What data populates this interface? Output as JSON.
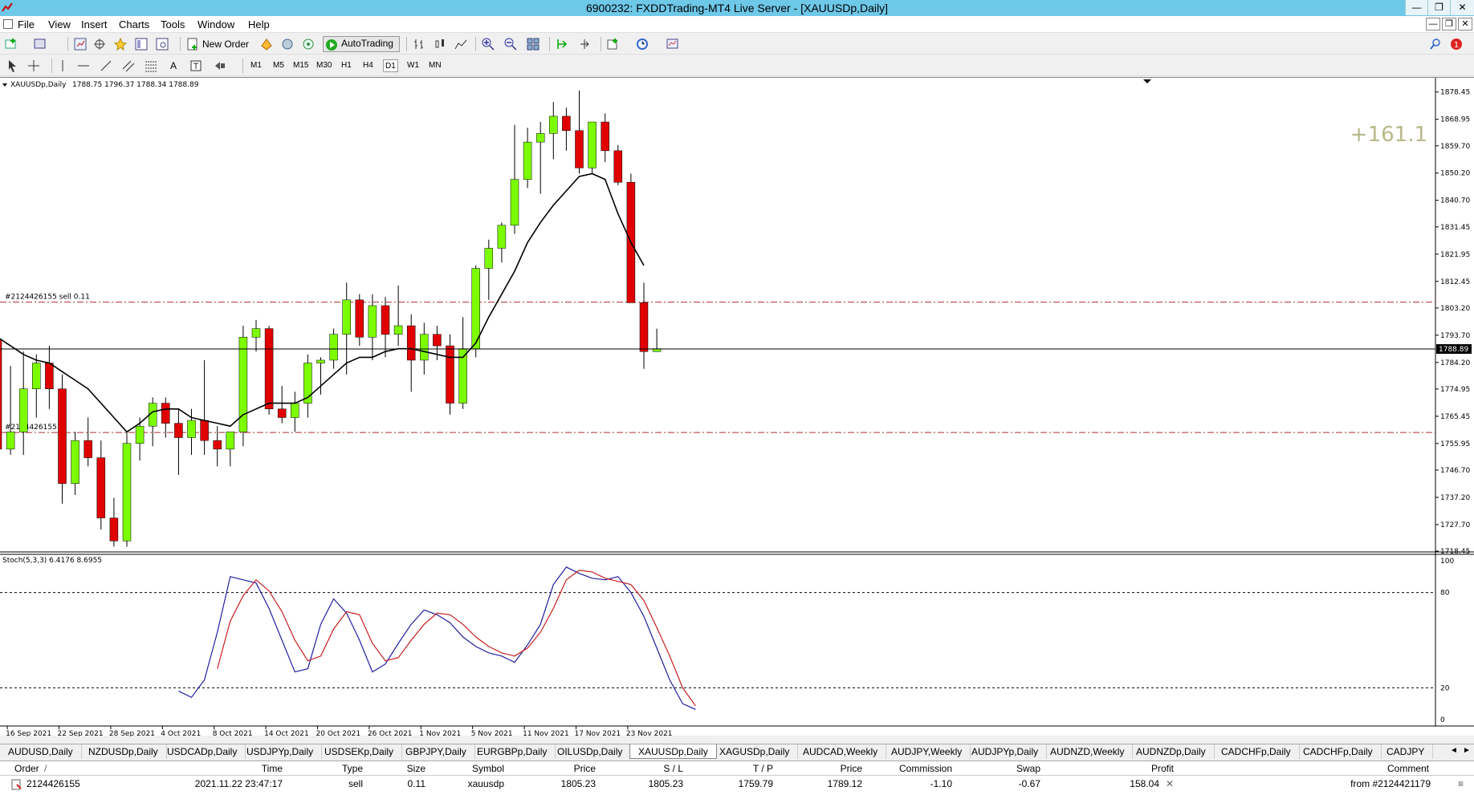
{
  "window": {
    "title": "6900232: FXDDTrading-MT4 Live Server - [XAUUSDp,Daily]"
  },
  "menu": [
    "File",
    "View",
    "Insert",
    "Charts",
    "Tools",
    "Window",
    "Help"
  ],
  "toolbar": {
    "new_order": "New Order",
    "auto_trading": "AutoTrading"
  },
  "timeframes": [
    "M1",
    "M5",
    "M15",
    "M30",
    "H1",
    "H4",
    "D1",
    "W1",
    "MN"
  ],
  "active_timeframe": "D1",
  "colors": {
    "bull": "#7cfc00",
    "bear": "#e00000",
    "stoch_main": "#1f1fa0",
    "stoch_signal": "#c81e1e",
    "order_line": "#b03030",
    "profit_text": "#b8b88a"
  },
  "chart_data": {
    "type": "candlestick",
    "symbol_label": "XAUUSDp,Daily",
    "ohlc_label": "1788.75 1796.37 1788.34 1788.89",
    "profit_label": "+161.1",
    "current_price_label": "1788.89",
    "current_price": 1788.89,
    "order_line_sell": {
      "label": "#2124426155 sell 0.11",
      "price": 1805.23
    },
    "order_line_tp": {
      "label": "#2124426155 tp",
      "price": 1759.79
    },
    "ylim": [
      1718.45,
      1882.0
    ],
    "price_ticks": [
      "1878.45",
      "1868.95",
      "1859.70",
      "1850.20",
      "1840.70",
      "1831.45",
      "1821.95",
      "1812.45",
      "1803.20",
      "1793.70",
      "1784.20",
      "1774.95",
      "1765.45",
      "1755.95",
      "1746.70",
      "1737.20",
      "1727.70",
      "1718.45"
    ],
    "date_labels": [
      "16 Sep 2021",
      "22 Sep 2021",
      "28 Sep 2021",
      "4 Oct 2021",
      "8 Oct 2021",
      "14 Oct 2021",
      "20 Oct 2021",
      "26 Oct 2021",
      "1 Nov 2021",
      "5 Nov 2021",
      "11 Nov 2021",
      "17 Nov 2021",
      "23 Nov 2021"
    ],
    "date_label_bars": [
      1,
      5,
      9,
      13,
      17,
      21,
      25,
      29,
      33,
      37,
      41,
      45,
      49
    ],
    "candles": [
      [
        1792,
        1796,
        1753,
        1754
      ],
      [
        1754,
        1783,
        1752,
        1760
      ],
      [
        1760,
        1788,
        1752,
        1775
      ],
      [
        1775,
        1787,
        1765,
        1784
      ],
      [
        1784,
        1790,
        1768,
        1775
      ],
      [
        1775,
        1780,
        1735,
        1742
      ],
      [
        1742,
        1760,
        1738,
        1757
      ],
      [
        1757,
        1765,
        1748,
        1751
      ],
      [
        1751,
        1757,
        1726,
        1730
      ],
      [
        1730,
        1737,
        1720,
        1722
      ],
      [
        1722,
        1760,
        1720,
        1756
      ],
      [
        1756,
        1765,
        1750,
        1762
      ],
      [
        1762,
        1772,
        1755,
        1770
      ],
      [
        1770,
        1772,
        1758,
        1763
      ],
      [
        1763,
        1768,
        1745,
        1758
      ],
      [
        1758,
        1768,
        1752,
        1764
      ],
      [
        1764,
        1785,
        1752,
        1757
      ],
      [
        1757,
        1762,
        1748,
        1754
      ],
      [
        1754,
        1760,
        1748,
        1760
      ],
      [
        1760,
        1797,
        1755,
        1793
      ],
      [
        1793,
        1799,
        1788,
        1796
      ],
      [
        1796,
        1797,
        1766,
        1768
      ],
      [
        1768,
        1776,
        1763,
        1765
      ],
      [
        1765,
        1774,
        1760,
        1770
      ],
      [
        1770,
        1787,
        1765,
        1784
      ],
      [
        1784,
        1786,
        1773,
        1785
      ],
      [
        1785,
        1796,
        1782,
        1794
      ],
      [
        1794,
        1812,
        1780,
        1806
      ],
      [
        1806,
        1808,
        1790,
        1793
      ],
      [
        1793,
        1808,
        1785,
        1804
      ],
      [
        1804,
        1807,
        1786,
        1794
      ],
      [
        1794,
        1811,
        1790,
        1797
      ],
      [
        1797,
        1801,
        1774,
        1785
      ],
      [
        1785,
        1798,
        1780,
        1794
      ],
      [
        1794,
        1797,
        1785,
        1790
      ],
      [
        1790,
        1794,
        1766,
        1770
      ],
      [
        1770,
        1800,
        1768,
        1789
      ],
      [
        1789,
        1818,
        1786,
        1817
      ],
      [
        1817,
        1827,
        1806,
        1824
      ],
      [
        1824,
        1833,
        1819,
        1832
      ],
      [
        1832,
        1867,
        1829,
        1848
      ],
      [
        1848,
        1866,
        1845,
        1861
      ],
      [
        1861,
        1868,
        1843,
        1864
      ],
      [
        1864,
        1875,
        1855,
        1870
      ],
      [
        1870,
        1873,
        1858,
        1865
      ],
      [
        1865,
        1879,
        1850,
        1852
      ],
      [
        1852,
        1867,
        1850,
        1868
      ],
      [
        1868,
        1871,
        1854,
        1858
      ],
      [
        1858,
        1860,
        1846,
        1847
      ],
      [
        1847,
        1850,
        1805,
        1805
      ],
      [
        1805,
        1812,
        1782,
        1788
      ],
      [
        1788,
        1796,
        1788,
        1789
      ]
    ],
    "ma": [
      1793,
      1790,
      1787,
      1785,
      1784,
      1781,
      1778,
      1775,
      1770,
      1765,
      1760,
      1763,
      1767,
      1768,
      1768,
      1765,
      1764,
      1763,
      1762,
      1766,
      1768,
      1770,
      1770,
      1770,
      1772,
      1776,
      1780,
      1784,
      1786,
      1786,
      1788,
      1789,
      1789,
      1788,
      1787,
      1786,
      1786,
      1791,
      1800,
      1808,
      1816,
      1826,
      1833,
      1839,
      1844,
      1849,
      1850,
      1848,
      1836,
      1826,
      1818
    ],
    "stoch_label": "Stoch(5,3,3) 6.4176 8.6955",
    "stoch_levels": [
      80,
      20
    ],
    "stoch_ticks": [
      "100",
      "80",
      "20",
      "0"
    ],
    "stoch_main": [
      null,
      null,
      null,
      null,
      null,
      null,
      null,
      18,
      14,
      25,
      55,
      90,
      88,
      86,
      70,
      50,
      30,
      32,
      60,
      76,
      67,
      50,
      30,
      35,
      48,
      60,
      69,
      66,
      61,
      52,
      46,
      42,
      40,
      36,
      47,
      60,
      85,
      96,
      92,
      89,
      88,
      90,
      80,
      65,
      45,
      25,
      10,
      6.4176
    ],
    "stoch_signal": [
      null,
      null,
      null,
      null,
      null,
      null,
      null,
      null,
      null,
      null,
      32,
      62,
      78,
      88,
      81,
      68,
      50,
      37,
      40,
      57,
      68,
      66,
      48,
      37,
      39,
      50,
      60,
      67,
      66,
      60,
      52,
      46,
      42,
      40,
      45,
      55,
      70,
      88,
      94,
      93,
      89,
      87,
      85,
      75,
      58,
      40,
      20,
      8.6955
    ],
    "stoch_start_bar": 7
  },
  "symbol_tabs": [
    "AUDUSD,Daily",
    "NZDUSDp,Daily",
    "USDCADp,Daily",
    "USDJPYp,Daily",
    "USDSEKp,Daily",
    "GBPJPY,Daily",
    "EURGBPp,Daily",
    "OILUSDp,Daily",
    "XAUUSDp,Daily",
    "XAGUSDp,Daily",
    "AUDCAD,Weekly",
    "AUDJPY,Weekly",
    "AUDJPYp,Daily",
    "AUDNZD,Weekly",
    "AUDNZDp,Daily",
    "CADCHFp,Daily",
    "CADCHFp,Daily",
    "CADJPY"
  ],
  "active_tab": "XAUUSDp,Daily",
  "orders": {
    "headers": [
      "Order",
      "Time",
      "Type",
      "Size",
      "Symbol",
      "Price",
      "S / L",
      "T / P",
      "Price",
      "Commission",
      "Swap",
      "Profit",
      "Comment"
    ],
    "rows": [
      [
        "2124426155",
        "2021.11.22 23:47:17",
        "sell",
        "0.11",
        "xauusdp",
        "1805.23",
        "1805.23",
        "1759.79",
        "1789.12",
        "-1.10",
        "-0.67",
        "158.04",
        "from #2124421179"
      ]
    ]
  }
}
